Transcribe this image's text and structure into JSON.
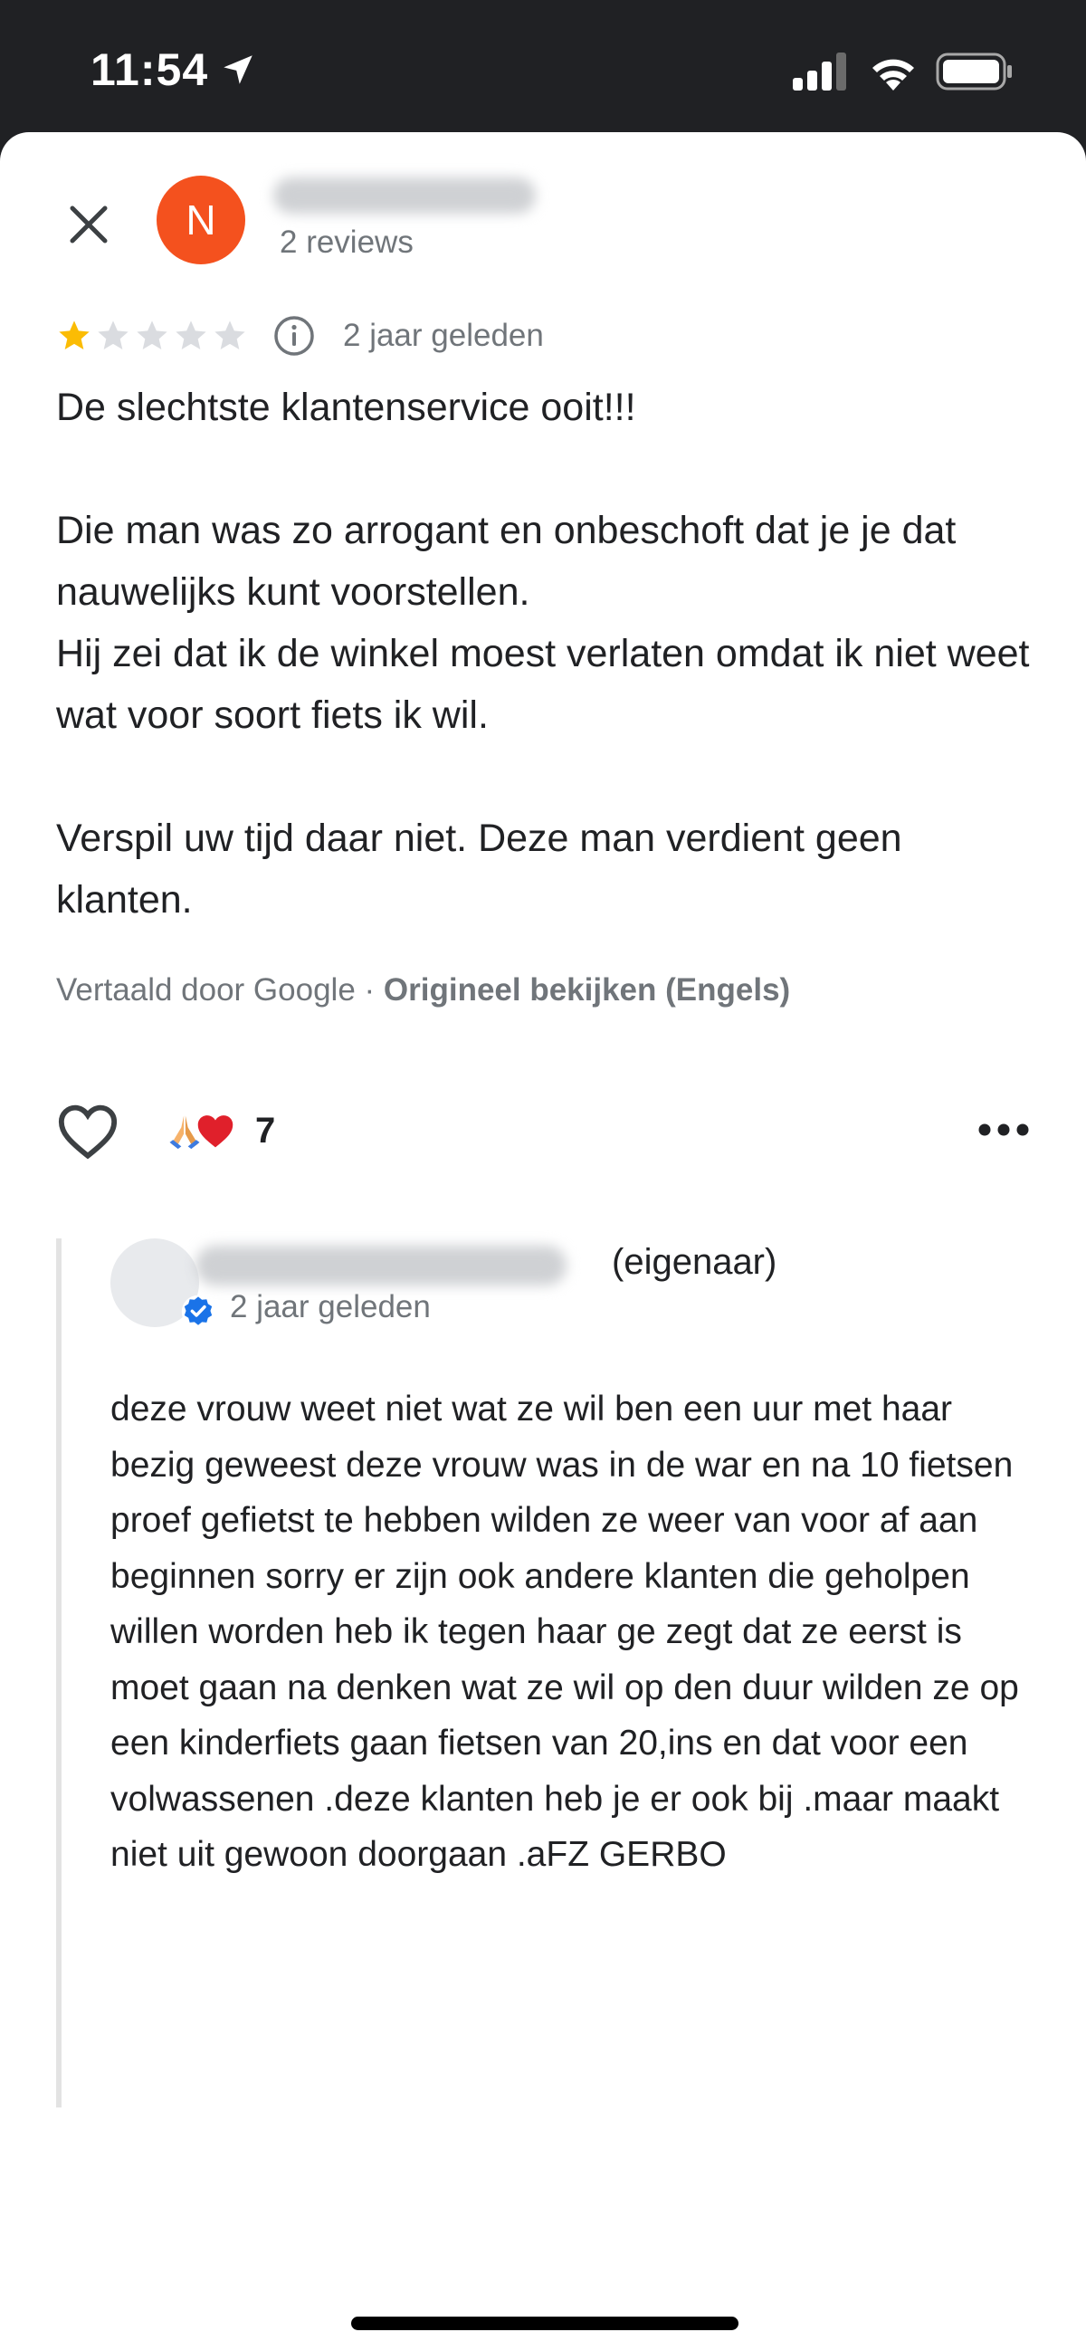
{
  "status_bar": {
    "time": "11:54"
  },
  "reviewer": {
    "avatar_initial": "N",
    "review_count": "2 reviews"
  },
  "review": {
    "rating": 1,
    "max_rating": 5,
    "date": "2 jaar geleden",
    "paragraphs": [
      "De slechtste klantenservice ooit!!!",
      "Die man was zo arrogant en onbeschoft dat je je dat nauwelijks kunt voorstellen.\nHij zei dat ik de winkel moest verlaten omdat ik niet weet wat voor soort fiets ik wil.",
      "Verspil uw tijd daar niet. Deze man verdient geen klanten."
    ],
    "translated_by": "Vertaald door Google · ",
    "view_original": "Origineel bekijken (Engels)"
  },
  "actions": {
    "reaction_count": "7"
  },
  "owner_reply": {
    "owner_label": "(eigenaar)",
    "date": "2 jaar geleden",
    "text": "deze vrouw weet niet wat ze wil ben een uur met haar bezig geweest deze vrouw was in de war en na 10 fietsen proef gefietst  te hebben wilden ze weer van voor af aan beginnen sorry er zijn ook andere klanten die geholpen willen worden heb ik tegen haar ge zegt dat  ze eerst is moet gaan na denken wat ze wil op den duur wilden ze op een kinderfiets gaan fietsen van 20,ins en dat voor een volwassenen .deze klanten heb je er ook bij  .maar maakt niet uit gewoon doorgaan .aFZ GERBO"
  },
  "colors": {
    "avatar_bg": "#f4511e",
    "star_filled": "#fbbc04",
    "star_empty": "#dadce0",
    "secondary_text": "#70757a",
    "verified_blue": "#1a73e8",
    "status_bar_bg": "#202124"
  },
  "icons": {
    "close": "close-icon",
    "info": "info-icon",
    "heart": "heart-outline-icon",
    "more": "more-horizontal-icon",
    "verified": "verified-check-icon",
    "reactions": [
      "folded-hands-emoji",
      "red-heart-emoji"
    ]
  }
}
